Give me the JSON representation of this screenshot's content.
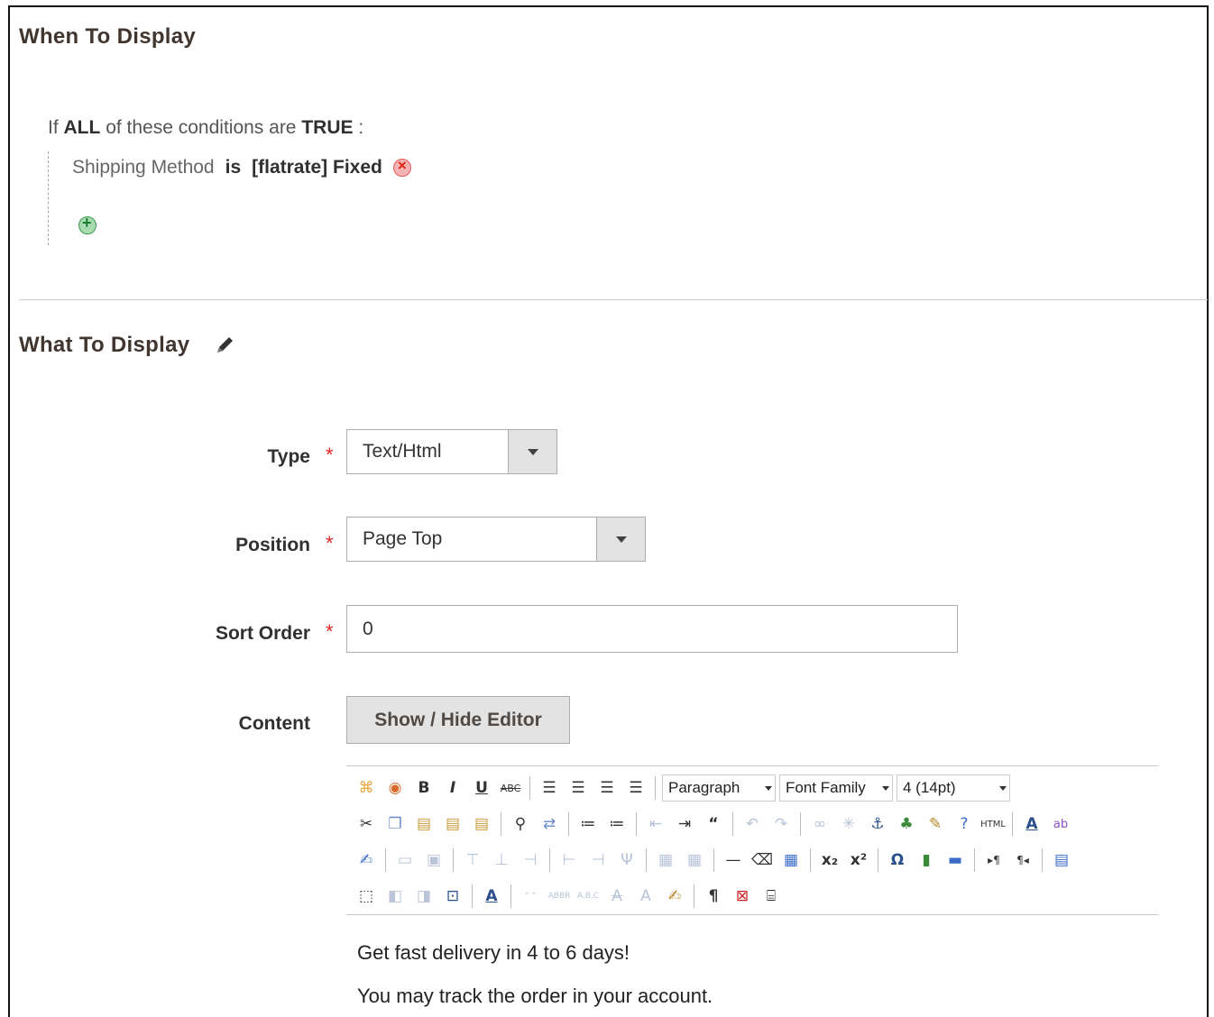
{
  "when_section": {
    "title": "When To Display",
    "conditions_prefix": "If",
    "aggregator": "ALL",
    "conditions_middle": "of these conditions are",
    "value": "TRUE",
    "conditions_suffix": ":",
    "condition": {
      "attribute": "Shipping Method",
      "operator": "is",
      "value": "[flatrate] Fixed"
    }
  },
  "what_section": {
    "title": "What To Display",
    "type_label": "Type",
    "type_value": "Text/Html",
    "position_label": "Position",
    "position_value": "Page Top",
    "sort_label": "Sort Order",
    "sort_value": "0",
    "content_label": "Content",
    "show_hide_label": "Show / Hide Editor",
    "required_mark": "*"
  },
  "editor": {
    "format_select": "Paragraph",
    "font_family_select": "Font Family",
    "font_size_select": "4 (14pt)",
    "lines": [
      "Get fast delivery in 4 to 6 days!",
      "You may track the order in your account."
    ]
  }
}
